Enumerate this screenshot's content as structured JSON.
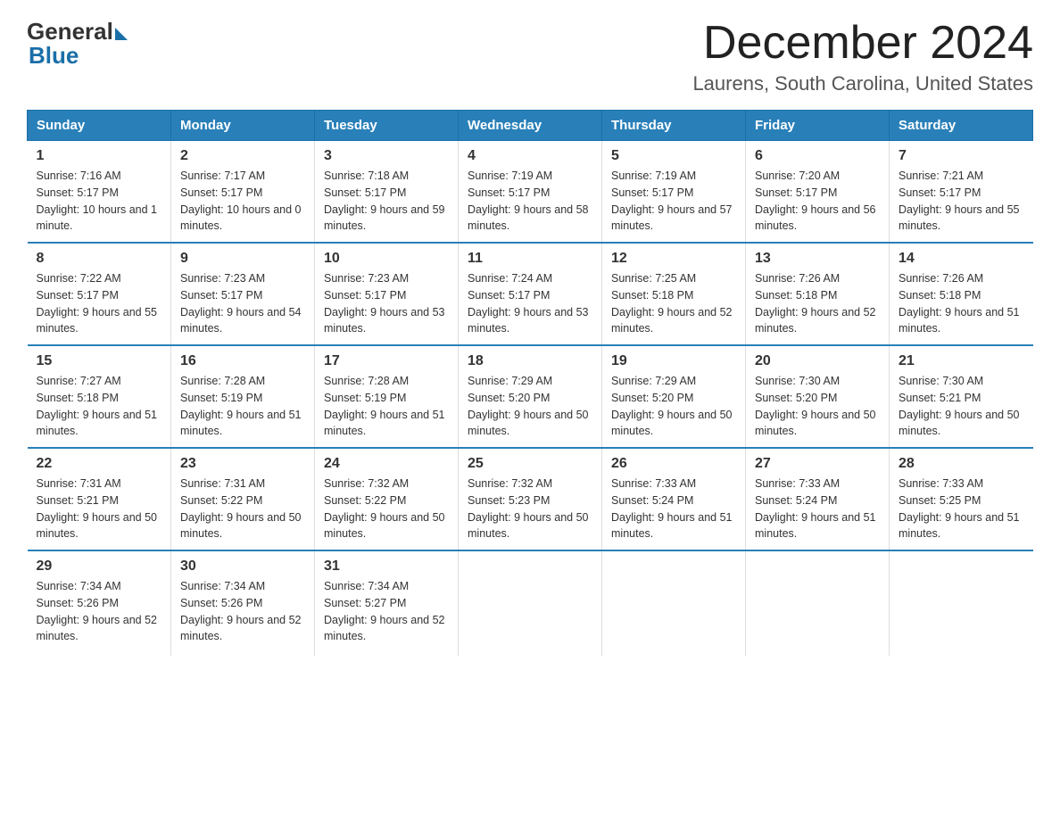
{
  "header": {
    "logo_general": "General",
    "logo_blue": "Blue",
    "title": "December 2024",
    "subtitle": "Laurens, South Carolina, United States"
  },
  "days_of_week": [
    "Sunday",
    "Monday",
    "Tuesday",
    "Wednesday",
    "Thursday",
    "Friday",
    "Saturday"
  ],
  "weeks": [
    [
      {
        "day": "1",
        "sunrise": "7:16 AM",
        "sunset": "5:17 PM",
        "daylight": "10 hours and 1 minute."
      },
      {
        "day": "2",
        "sunrise": "7:17 AM",
        "sunset": "5:17 PM",
        "daylight": "10 hours and 0 minutes."
      },
      {
        "day": "3",
        "sunrise": "7:18 AM",
        "sunset": "5:17 PM",
        "daylight": "9 hours and 59 minutes."
      },
      {
        "day": "4",
        "sunrise": "7:19 AM",
        "sunset": "5:17 PM",
        "daylight": "9 hours and 58 minutes."
      },
      {
        "day": "5",
        "sunrise": "7:19 AM",
        "sunset": "5:17 PM",
        "daylight": "9 hours and 57 minutes."
      },
      {
        "day": "6",
        "sunrise": "7:20 AM",
        "sunset": "5:17 PM",
        "daylight": "9 hours and 56 minutes."
      },
      {
        "day": "7",
        "sunrise": "7:21 AM",
        "sunset": "5:17 PM",
        "daylight": "9 hours and 55 minutes."
      }
    ],
    [
      {
        "day": "8",
        "sunrise": "7:22 AM",
        "sunset": "5:17 PM",
        "daylight": "9 hours and 55 minutes."
      },
      {
        "day": "9",
        "sunrise": "7:23 AM",
        "sunset": "5:17 PM",
        "daylight": "9 hours and 54 minutes."
      },
      {
        "day": "10",
        "sunrise": "7:23 AM",
        "sunset": "5:17 PM",
        "daylight": "9 hours and 53 minutes."
      },
      {
        "day": "11",
        "sunrise": "7:24 AM",
        "sunset": "5:17 PM",
        "daylight": "9 hours and 53 minutes."
      },
      {
        "day": "12",
        "sunrise": "7:25 AM",
        "sunset": "5:18 PM",
        "daylight": "9 hours and 52 minutes."
      },
      {
        "day": "13",
        "sunrise": "7:26 AM",
        "sunset": "5:18 PM",
        "daylight": "9 hours and 52 minutes."
      },
      {
        "day": "14",
        "sunrise": "7:26 AM",
        "sunset": "5:18 PM",
        "daylight": "9 hours and 51 minutes."
      }
    ],
    [
      {
        "day": "15",
        "sunrise": "7:27 AM",
        "sunset": "5:18 PM",
        "daylight": "9 hours and 51 minutes."
      },
      {
        "day": "16",
        "sunrise": "7:28 AM",
        "sunset": "5:19 PM",
        "daylight": "9 hours and 51 minutes."
      },
      {
        "day": "17",
        "sunrise": "7:28 AM",
        "sunset": "5:19 PM",
        "daylight": "9 hours and 51 minutes."
      },
      {
        "day": "18",
        "sunrise": "7:29 AM",
        "sunset": "5:20 PM",
        "daylight": "9 hours and 50 minutes."
      },
      {
        "day": "19",
        "sunrise": "7:29 AM",
        "sunset": "5:20 PM",
        "daylight": "9 hours and 50 minutes."
      },
      {
        "day": "20",
        "sunrise": "7:30 AM",
        "sunset": "5:20 PM",
        "daylight": "9 hours and 50 minutes."
      },
      {
        "day": "21",
        "sunrise": "7:30 AM",
        "sunset": "5:21 PM",
        "daylight": "9 hours and 50 minutes."
      }
    ],
    [
      {
        "day": "22",
        "sunrise": "7:31 AM",
        "sunset": "5:21 PM",
        "daylight": "9 hours and 50 minutes."
      },
      {
        "day": "23",
        "sunrise": "7:31 AM",
        "sunset": "5:22 PM",
        "daylight": "9 hours and 50 minutes."
      },
      {
        "day": "24",
        "sunrise": "7:32 AM",
        "sunset": "5:22 PM",
        "daylight": "9 hours and 50 minutes."
      },
      {
        "day": "25",
        "sunrise": "7:32 AM",
        "sunset": "5:23 PM",
        "daylight": "9 hours and 50 minutes."
      },
      {
        "day": "26",
        "sunrise": "7:33 AM",
        "sunset": "5:24 PM",
        "daylight": "9 hours and 51 minutes."
      },
      {
        "day": "27",
        "sunrise": "7:33 AM",
        "sunset": "5:24 PM",
        "daylight": "9 hours and 51 minutes."
      },
      {
        "day": "28",
        "sunrise": "7:33 AM",
        "sunset": "5:25 PM",
        "daylight": "9 hours and 51 minutes."
      }
    ],
    [
      {
        "day": "29",
        "sunrise": "7:34 AM",
        "sunset": "5:26 PM",
        "daylight": "9 hours and 52 minutes."
      },
      {
        "day": "30",
        "sunrise": "7:34 AM",
        "sunset": "5:26 PM",
        "daylight": "9 hours and 52 minutes."
      },
      {
        "day": "31",
        "sunrise": "7:34 AM",
        "sunset": "5:27 PM",
        "daylight": "9 hours and 52 minutes."
      },
      null,
      null,
      null,
      null
    ]
  ],
  "labels": {
    "sunrise": "Sunrise:",
    "sunset": "Sunset:",
    "daylight": "Daylight:"
  }
}
